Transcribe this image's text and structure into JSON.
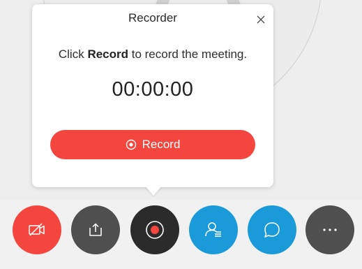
{
  "popover": {
    "title": "Recorder",
    "instruction_prefix": "Click ",
    "instruction_bold": "Record",
    "instruction_suffix": " to record the meeting.",
    "timer": "00:00:00",
    "record_label": "Record"
  },
  "icons": {
    "close": "close-icon",
    "record_target": "record-target-icon",
    "video_off": "video-off-icon",
    "share": "share-icon",
    "record": "record-icon",
    "participants": "participants-icon",
    "chat": "chat-icon",
    "more": "more-icon"
  },
  "colors": {
    "record_red": "#f4463e",
    "dark_gray": "#4f4f4f",
    "record_dark": "#2b2b2b",
    "blue": "#1a9ad8"
  }
}
